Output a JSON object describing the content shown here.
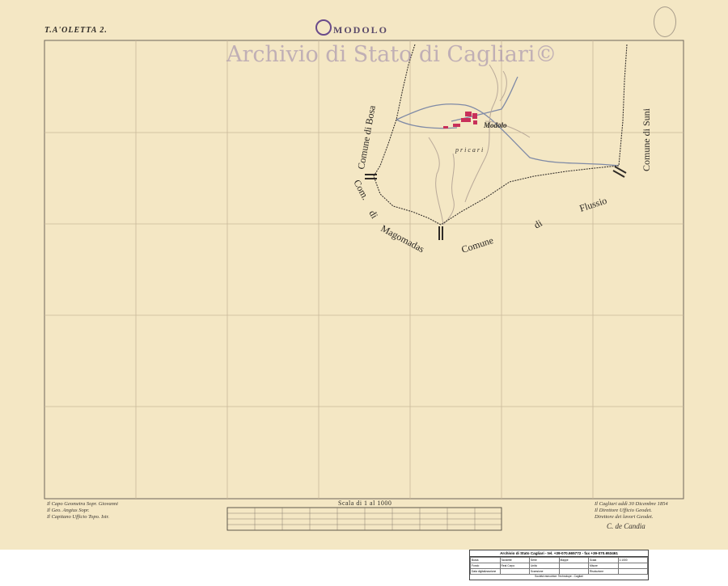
{
  "sheet_label": "T.A'OLETTA 2.",
  "title": "MODOLO",
  "watermark": "Archivio di Stato di Cagliari©",
  "map_labels": {
    "comune_bosa": "Comune di Bosa",
    "comune_magomadas_1": "Com.",
    "comune_magomadas_2": "di",
    "comune_magomadas_3": "Magomadas",
    "comune_flussio_1": "Comune",
    "comune_flussio_2": "di",
    "comune_flussio_3": "Flussio",
    "comune_suni": "Comune di Suni",
    "modolo": "Modolo",
    "place_ppiccari": "p r i c a r i"
  },
  "left_notes": [
    "Il Capo Geometra Sopr. Giovanni",
    "Il Geo. Angius Sopr.",
    "Il Capitano Ufficio Topo. Istr."
  ],
  "right_notes": [
    "Il Cagliari addì 30 Dicembre 1854",
    "Il Direttore Ufficio Geodet.",
    "Direttore dei lavori Geodet.",
    "C. de Candia"
  ],
  "scale_title": "Scala di 1 al 1000",
  "info": {
    "header": "Archivio di Stato Cagliari - tel. +39-070.665772 - fax +39-070.653461",
    "rows": [
      [
        "Busta",
        "Tavolette",
        "Serie",
        "Mappe",
        "Scala",
        "1:1000"
      ],
      [
        "Fondo",
        "Real Corpo",
        "Unità",
        "",
        "Misure",
        ""
      ],
      [
        "Data digitalizzazione",
        "",
        "Scansione",
        "",
        "Risoluzione",
        ""
      ]
    ],
    "footer": "Società esecutrice: Technolupe - Cagliari"
  },
  "colors": {
    "paper": "#f4e7c4",
    "grid": "#c9b89a",
    "frame": "#6e645a",
    "road": "#7f8aa6",
    "boundary": "#3a3530",
    "settlement": "#c8305a",
    "river": "#b9a999"
  }
}
